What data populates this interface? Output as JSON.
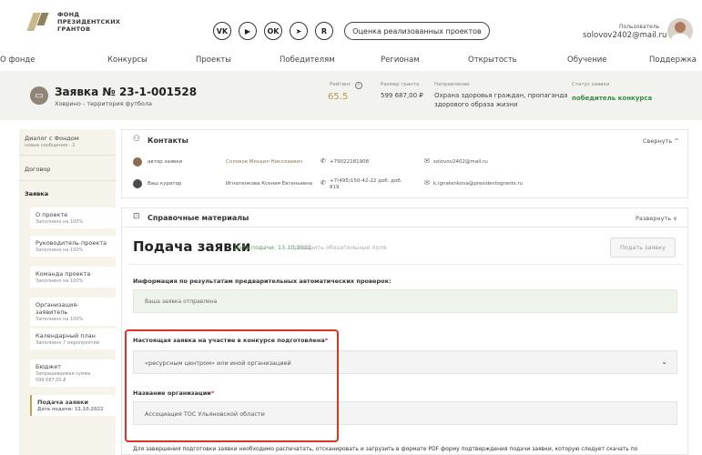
{
  "logo": {
    "line1": "ФОНД",
    "line2": "ПРЕЗИДЕНТСКИХ",
    "line3": "ГРАНТОВ"
  },
  "social": {
    "vk": "VK",
    "youtube": "▶",
    "ok": "OK",
    "telegram": "➤",
    "rutube": "R"
  },
  "header": {
    "eval_button": "Оценка реализованных проектов",
    "user_role": "Пользователь",
    "user_email": "solovov2402@mail.ru"
  },
  "nav": [
    "О фонде",
    "Конкурсы",
    "Проекты",
    "Победителям",
    "Регионам",
    "Открытость",
    "Обучение",
    "Поддержка"
  ],
  "application": {
    "title": "Заявка № 23-1-001528",
    "subtitle": "Ховрино - территория футбола",
    "rating_label": "Рейтинг",
    "rating_value": "65.5",
    "grant_label": "Размер гранта",
    "grant_value": "599 687,00 ₽",
    "direction_label": "Направление",
    "direction_value_1": "Охрана здоровья граждан, пропаганда",
    "direction_value_2": "здорового образа жизни",
    "status_label": "Статус заявки",
    "status_value": "победитель конкурса"
  },
  "sidebar": {
    "dialog": {
      "label": "Диалог с Фондом",
      "sub": "новые сообщения - 2"
    },
    "contract": {
      "label": "Договор"
    },
    "application": {
      "label": "Заявка"
    },
    "children": [
      {
        "label": "О проекте",
        "sub": "Заполнено на 100%"
      },
      {
        "label": "Руководитель проекта",
        "sub": "Заполнено на 100%"
      },
      {
        "label": "Команда проекта",
        "sub": "Заполнено на 100%"
      },
      {
        "label": "Организация-заявитель",
        "sub": "Заполнено на 100%"
      },
      {
        "label": "Календарный план",
        "sub": "Заполнено 7 мероприятий"
      },
      {
        "label": "Бюджет",
        "sub": "Запрашиваемая сумма",
        "sub2": "599 687,00 ₽"
      },
      {
        "label": "Подача заявки",
        "sub": "Дата подачи: 13.10.2022"
      }
    ]
  },
  "contacts": {
    "title": "Контакты",
    "toggle": "Свернуть ^",
    "rows": [
      {
        "role": "автор заявки",
        "name": "Соловов Михаил Николаевич",
        "phone": "+79022181908",
        "email": "solovov2402@mail.ru"
      },
      {
        "role": "Ваш куратор",
        "name": "Игнатенкова Ксения Евгеньевна",
        "phone": "+7(495)150-42-22 доб. доб. 819",
        "email": "k.ignatenkova@presidentsgrants.ru"
      }
    ]
  },
  "references": {
    "title": "Справочные материалы",
    "toggle": "Развернуть ∨"
  },
  "submission": {
    "title": "Подача заявки",
    "date": "Дата подачи: 13.10.2022",
    "check_link": "Проверить обязательные поля",
    "submit_button": "Подать заявку",
    "info_heading": "Информация по результатам предварительных автоматических проверок:",
    "check_result": "Ваша заявка отправлена",
    "prepared_label": "Настоящая заявка на участие в конкурсе подготовлена",
    "prepared_value": "«ресурсным центром» или иной организацией",
    "org_label": "Название организации",
    "org_value": "Ассоциация ТОС Ульяновской области",
    "bottom_note": "Для завершения подготовки заявки необходимо распечатать, отсканировать и загрузить в формате PDF форму подтверждения подачи заявки, которую следует скачать по"
  }
}
